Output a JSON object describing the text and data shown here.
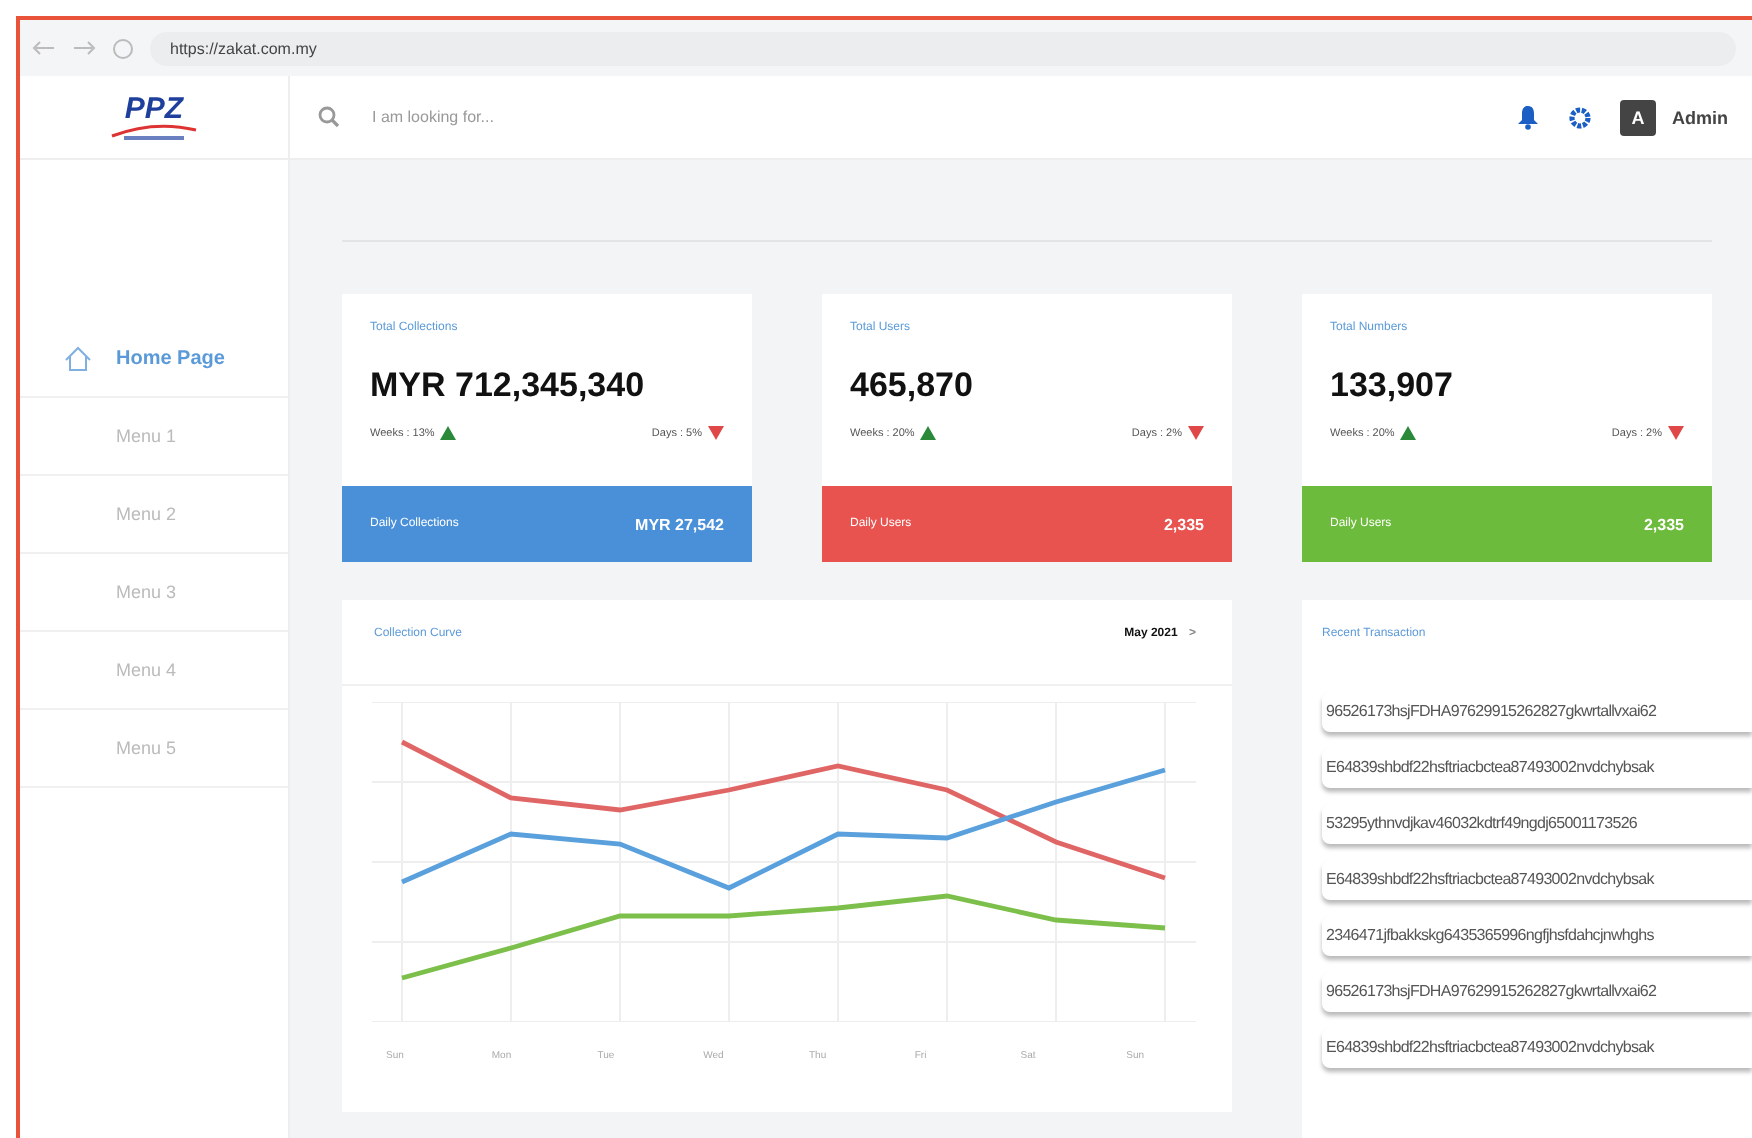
{
  "browser": {
    "url": "https://zakat.com.my"
  },
  "header": {
    "logo": "PPZ",
    "search": {
      "placeholder": "I am looking for..."
    },
    "avatar": "A",
    "user": "Admin"
  },
  "sidebar": {
    "items": [
      {
        "label": "Home Page",
        "selected": true
      },
      {
        "label": "Menu 1",
        "selected": false
      },
      {
        "label": "Menu 2",
        "selected": false
      },
      {
        "label": "Menu 3",
        "selected": false
      },
      {
        "label": "Menu 4",
        "selected": false
      },
      {
        "label": "Menu 5",
        "selected": false
      }
    ]
  },
  "cards": [
    {
      "title": "Total Collections",
      "value": "MYR 712,345,340",
      "weeks": "Weeks : 13%",
      "weeks_rising": true,
      "days": "Days : 5%",
      "days_rising": false,
      "color": "#4a90d9",
      "footer_label": "Daily Collections",
      "footer_value": "MYR 27,542"
    },
    {
      "title": "Total Users",
      "value": "465,870",
      "weeks": "Weeks : 20%",
      "weeks_rising": true,
      "days": "Days : 2%",
      "days_rising": false,
      "color": "#e8534f",
      "footer_label": "Daily Users",
      "footer_value": "2,335"
    },
    {
      "title": "Total Numbers",
      "value": "133,907",
      "weeks": "Weeks : 20%",
      "weeks_rising": true,
      "days": "Days : 2%",
      "days_rising": false,
      "color": "#6cbb3c",
      "footer_label": "Daily Users",
      "footer_value": "2,335"
    }
  ],
  "chart_panel": {
    "title": "Collection Curve",
    "period": "May 2021",
    "caret": ">",
    "days": [
      "Sun",
      "Mon",
      "Tue",
      "Wed",
      "Thu",
      "Fri",
      "Sat",
      "Sun"
    ]
  },
  "transactions": {
    "title": "Recent Transaction",
    "rows": [
      "96526173hsjFDHA97629915262827gkwrtallvxai62",
      "E64839shbdf22hsftriacbctea87493002nvdchybsak",
      "53295ythnvdjkav46032kdtrf49ngdj65001173526",
      "E64839shbdf22hsftriacbctea87493002nvdchybsak",
      "2346471jfbakkskg6435365996ngfjhsfdahcjnwhghs",
      "96526173hsjFDHA97629915262827gkwrtallvxai62",
      "E64839shbdf22hsftriacbctea87493002nvdchybsak"
    ]
  }
}
